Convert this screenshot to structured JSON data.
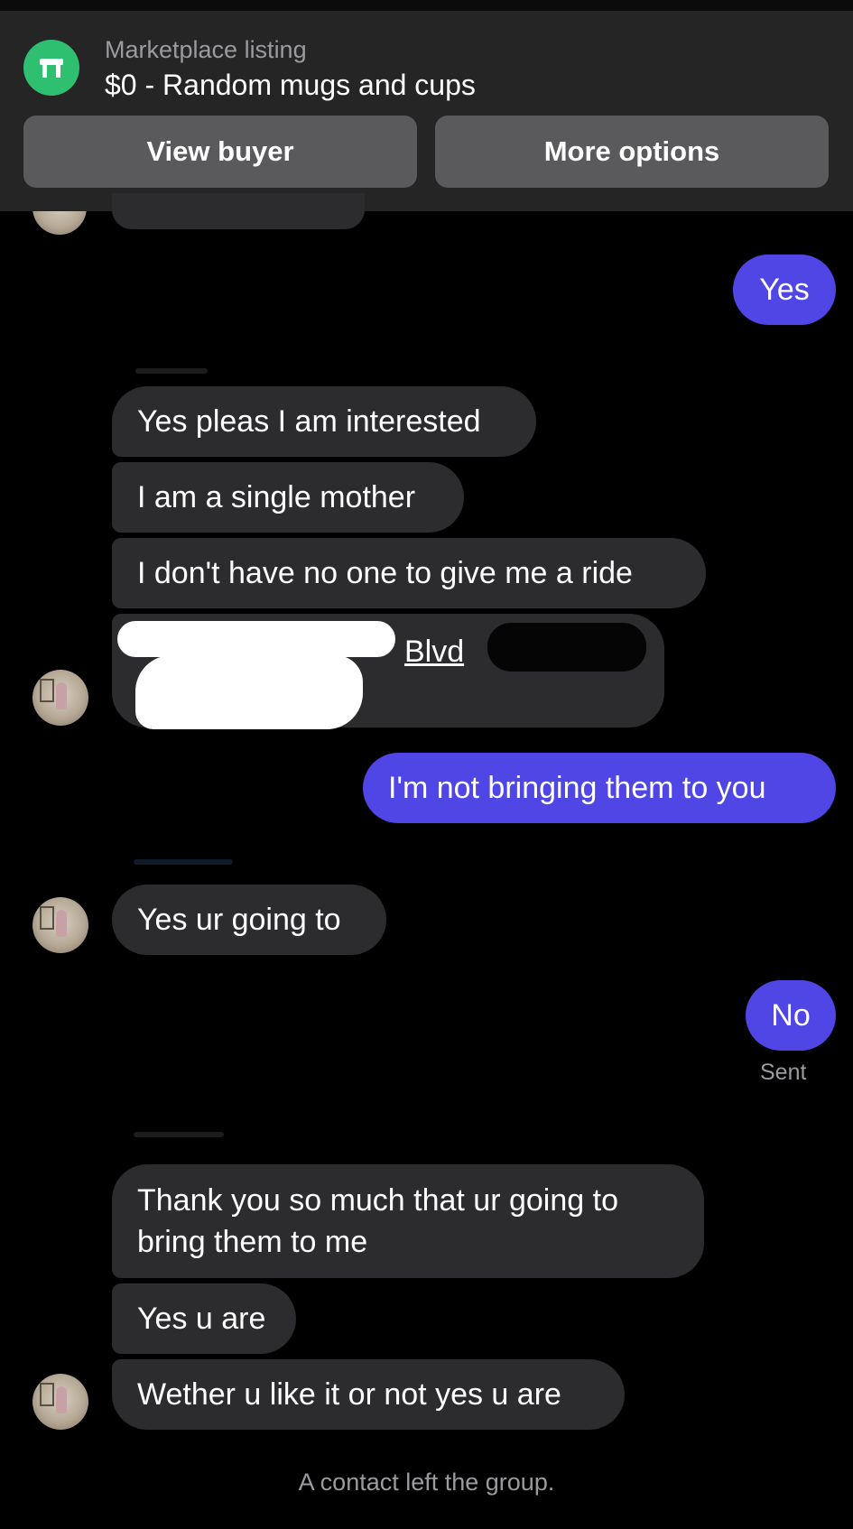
{
  "header": {
    "listing_label": "Marketplace listing",
    "listing_title": "$0 - Random mugs and cups",
    "view_buyer_label": "View buyer",
    "more_options_label": "More options",
    "icon": "marketplace-shop-icon",
    "icon_color": "#2fbf71"
  },
  "colors": {
    "background": "#000000",
    "header_bg": "#252526",
    "incoming_bubble": "#2c2c2e",
    "outgoing_bubble": "#4f46e5",
    "muted_text": "#9b9b9f"
  },
  "messages": [
    {
      "from": "me",
      "text": "Yes"
    },
    {
      "from": "them",
      "text": "Yes pleas I am interested"
    },
    {
      "from": "them",
      "text": "I am a single mother"
    },
    {
      "from": "them",
      "text": "I don't have no one to give me a ride"
    },
    {
      "from": "them",
      "text": "Blvd",
      "note": "address partially redacted"
    },
    {
      "from": "me",
      "text": "I'm not bringing them to you"
    },
    {
      "from": "them",
      "text": "Yes ur going to"
    },
    {
      "from": "me",
      "text": "No"
    },
    {
      "from": "them",
      "text": "Thank you so much that ur going to\nbring them to me"
    },
    {
      "from": "them",
      "text": "Yes u are"
    },
    {
      "from": "them",
      "text": "Wether u like it or not yes u are"
    }
  ],
  "status": {
    "sent_label": "Sent",
    "footer_text": "A contact left the group."
  }
}
